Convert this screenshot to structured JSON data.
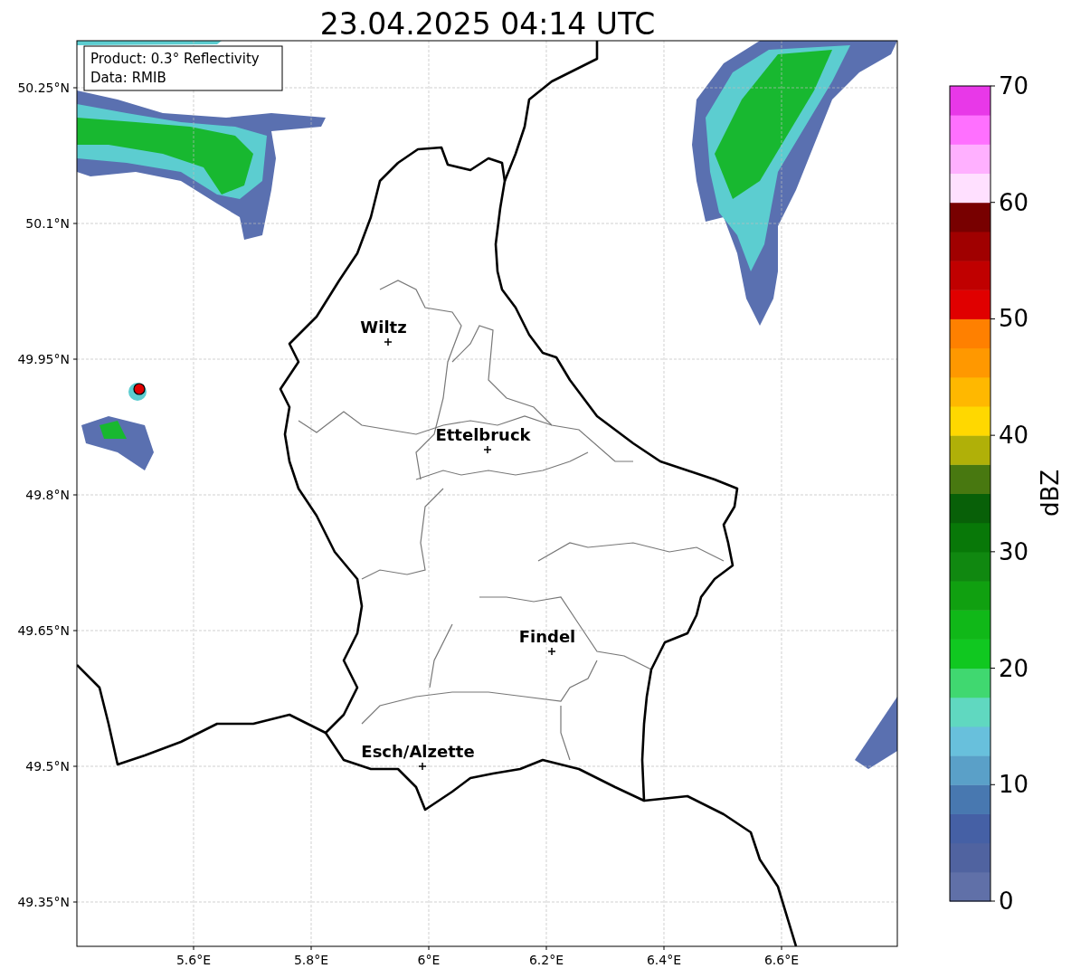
{
  "title": "23.04.2025 04:14 UTC",
  "info_box": [
    "Product: 0.3° Reflectivity",
    "Data: RMIB"
  ],
  "y_ticks": [
    "50.25°N",
    "50.1°N",
    "49.95°N",
    "49.8°N",
    "49.65°N",
    "49.5°N",
    "49.35°N"
  ],
  "x_ticks": [
    "5.6°E",
    "5.8°E",
    "6°E",
    "6.2°E",
    "6.4°E",
    "6.6°E"
  ],
  "cities": [
    {
      "name": "Wiltz"
    },
    {
      "name": "Ettelbruck"
    },
    {
      "name": "Findel"
    },
    {
      "name": "Esch/Alzette"
    }
  ],
  "colorbar": {
    "label": "dBZ",
    "ticks": [
      "70",
      "60",
      "50",
      "40",
      "30",
      "20",
      "10",
      "0"
    ],
    "segments": [
      {
        "color": "#6070a8"
      },
      {
        "color": "#5063a0"
      },
      {
        "color": "#4560a5"
      },
      {
        "color": "#4878b0"
      },
      {
        "color": "#5aa0c8"
      },
      {
        "color": "#68c0dc"
      },
      {
        "color": "#60d8c0"
      },
      {
        "color": "#40d870"
      },
      {
        "color": "#10c820"
      },
      {
        "color": "#10b818"
      },
      {
        "color": "#10a010"
      },
      {
        "color": "#108810"
      },
      {
        "color": "#087808"
      },
      {
        "color": "#086008"
      },
      {
        "color": "#487810"
      },
      {
        "color": "#b0b008"
      },
      {
        "color": "#ffd800"
      },
      {
        "color": "#ffb800"
      },
      {
        "color": "#ff9800"
      },
      {
        "color": "#ff8000"
      },
      {
        "color": "#e00000"
      },
      {
        "color": "#c00000"
      },
      {
        "color": "#a00000"
      },
      {
        "color": "#780000"
      },
      {
        "color": "#ffe0ff"
      },
      {
        "color": "#ffb0ff"
      },
      {
        "color": "#ff70ff"
      },
      {
        "color": "#e838e8"
      }
    ]
  }
}
